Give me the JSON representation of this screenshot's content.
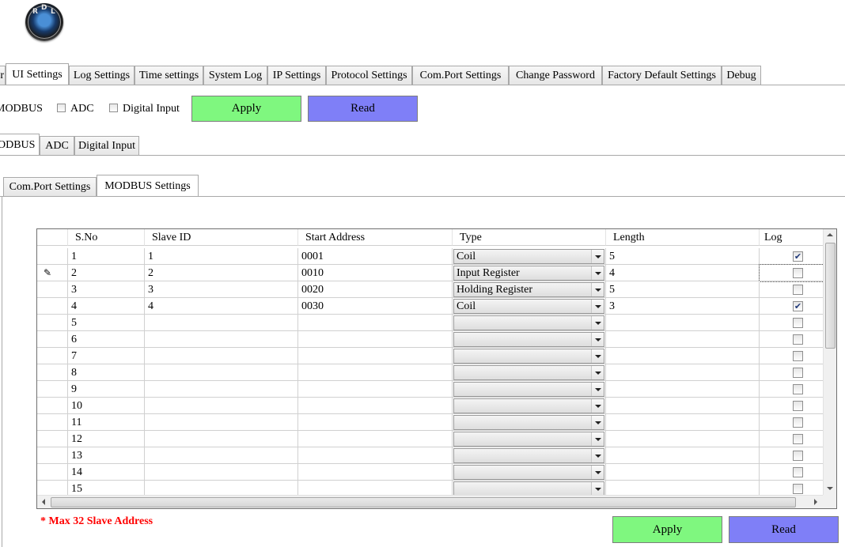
{
  "logo": {
    "letters": [
      "R",
      "D",
      "L"
    ],
    "alt": "RDL logo"
  },
  "main_tabs": [
    {
      "label": "r"
    },
    {
      "label": "UI Settings",
      "active": true
    },
    {
      "label": "Log Settings"
    },
    {
      "label": "Time settings"
    },
    {
      "label": "System Log"
    },
    {
      "label": "IP Settings"
    },
    {
      "label": "Protocol Settings"
    },
    {
      "label": "Com.Port Settings"
    },
    {
      "label": "Change Password"
    },
    {
      "label": "Factory Default Settings"
    },
    {
      "label": "Debug"
    }
  ],
  "top_options": {
    "modbus_label": "MODBUS",
    "adc_label": "ADC",
    "digital_input_label": "Digital Input",
    "apply_label": "Apply",
    "read_label": "Read"
  },
  "sub_tabs": [
    {
      "label": "ODBUS",
      "active": true
    },
    {
      "label": "ADC"
    },
    {
      "label": "Digital Input"
    }
  ],
  "inner_tabs": [
    {
      "label": "Com.Port Settings"
    },
    {
      "label": "MODBUS Settings",
      "active": true
    }
  ],
  "grid": {
    "columns": [
      "S.No",
      "Slave ID",
      "Start Address",
      "Type",
      "Length",
      "Log"
    ],
    "rows": [
      {
        "sno": "1",
        "slave": "1",
        "addr": "0001",
        "type": "Coil",
        "len": "5",
        "log": true
      },
      {
        "sno": "2",
        "slave": "2",
        "addr": "0010",
        "type": "Input Register",
        "len": "4",
        "log": false,
        "editing": true
      },
      {
        "sno": "3",
        "slave": "3",
        "addr": "0020",
        "type": "Holding Register",
        "len": "5",
        "log": false
      },
      {
        "sno": "4",
        "slave": "4",
        "addr": "0030",
        "type": "Coil",
        "len": "3",
        "log": true
      },
      {
        "sno": "5",
        "slave": "",
        "addr": "",
        "type": "",
        "len": "",
        "log": false
      },
      {
        "sno": "6",
        "slave": "",
        "addr": "",
        "type": "",
        "len": "",
        "log": false
      },
      {
        "sno": "7",
        "slave": "",
        "addr": "",
        "type": "",
        "len": "",
        "log": false
      },
      {
        "sno": "8",
        "slave": "",
        "addr": "",
        "type": "",
        "len": "",
        "log": false
      },
      {
        "sno": "9",
        "slave": "",
        "addr": "",
        "type": "",
        "len": "",
        "log": false
      },
      {
        "sno": "10",
        "slave": "",
        "addr": "",
        "type": "",
        "len": "",
        "log": false
      },
      {
        "sno": "11",
        "slave": "",
        "addr": "",
        "type": "",
        "len": "",
        "log": false
      },
      {
        "sno": "12",
        "slave": "",
        "addr": "",
        "type": "",
        "len": "",
        "log": false
      },
      {
        "sno": "13",
        "slave": "",
        "addr": "",
        "type": "",
        "len": "",
        "log": false
      },
      {
        "sno": "14",
        "slave": "",
        "addr": "",
        "type": "",
        "len": "",
        "log": false
      },
      {
        "sno": "15",
        "slave": "",
        "addr": "",
        "type": "",
        "len": "",
        "log": false
      }
    ]
  },
  "note": "* Max 32 Slave Address",
  "bottom_buttons": {
    "apply_label": "Apply",
    "read_label": "Read"
  },
  "colors": {
    "apply": "#7ff77f",
    "read": "#7f7ff7",
    "note": "#ff0000"
  }
}
